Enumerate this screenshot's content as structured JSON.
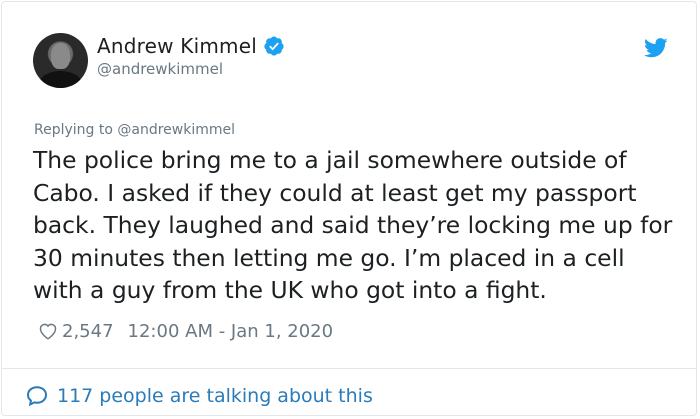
{
  "author": {
    "name": "Andrew Kimmel",
    "handle": "@andrewkimmel",
    "verified": true
  },
  "reply_context": {
    "prefix": "Replying to ",
    "handle": "@andrewkimmel"
  },
  "tweet": {
    "text": "The police bring me to a jail somewhere outside of Cabo. I asked if they could at least get my passport back. They laughed and said they’re locking me up for 30 minutes then letting me go. I’m placed in a cell with a guy from the UK who got into a fight."
  },
  "meta": {
    "likes": "2,547",
    "timestamp": "12:00 AM - Jan 1, 2020"
  },
  "footer": {
    "talking": "117 people are talking about this"
  },
  "colors": {
    "text": "#1c2022",
    "secondary": "#697882",
    "link": "#2b7bb9",
    "twitter_blue": "#1da1f2",
    "border": "#e1e8ed"
  },
  "icons": [
    "avatar",
    "verified-badge-icon",
    "twitter-bird-icon",
    "heart-icon",
    "speech-bubble-icon"
  ]
}
